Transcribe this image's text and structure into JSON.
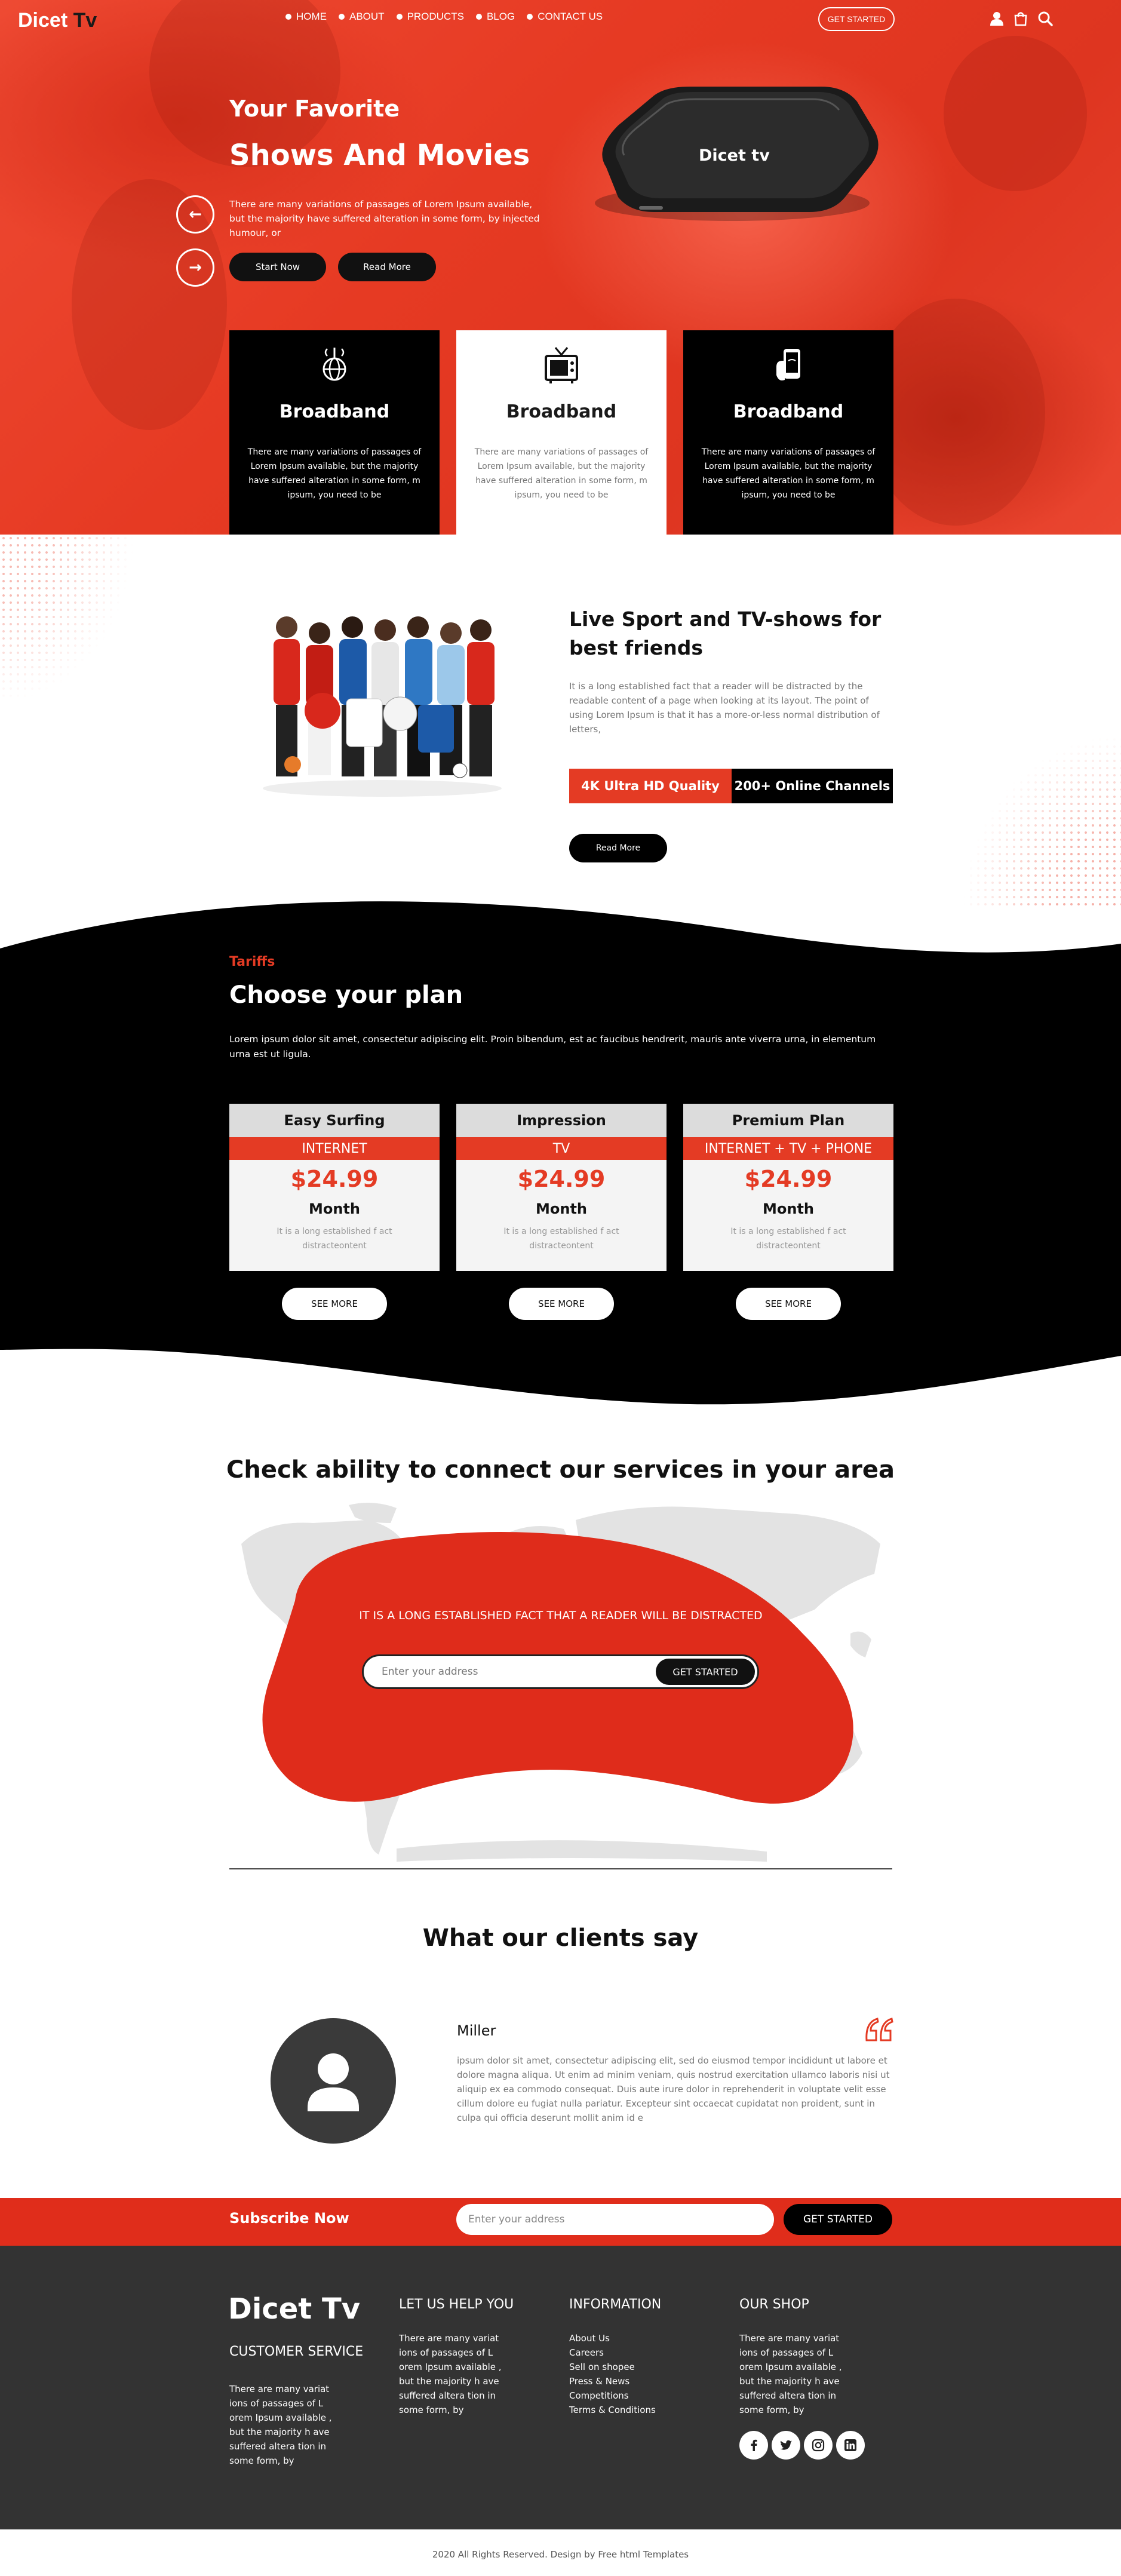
{
  "brand": {
    "name_part1": "Dicet ",
    "name_part2": "Tv",
    "accent_color": "#e43b24"
  },
  "nav": {
    "items": [
      {
        "label": "HOME"
      },
      {
        "label": "ABOUT"
      },
      {
        "label": "PRODUCTS"
      },
      {
        "label": "BLOG"
      },
      {
        "label": "CONTACT US"
      }
    ],
    "cta_label": "GET STARTED",
    "icons": [
      "user-icon",
      "shopping-bag-icon",
      "search-icon"
    ]
  },
  "hero": {
    "title_line1": "Your Favorite",
    "title_line2": "Shows And Movies",
    "paragraph": "There are many variations of passages of Lorem Ipsum available, but the majority have suffered alteration in some form, by injected humour, or",
    "start_button": "Start Now",
    "read_button": "Read More",
    "device_label": "Dicet tv",
    "prev_icon": "arrow-left-icon",
    "next_icon": "arrow-right-icon"
  },
  "features": [
    {
      "icon": "globe-signal-icon",
      "title": "Broadband",
      "text": "There are many variations of passages of Lorem Ipsum available, but the majority have suffered alteration in some form, m ipsum, you need to be"
    },
    {
      "icon": "tv-icon",
      "title": "Broadband",
      "text": "There are many variations of passages of Lorem Ipsum available, but the majority have suffered alteration in some form, m ipsum, you need to be"
    },
    {
      "icon": "phone-hand-icon",
      "title": "Broadband",
      "text": "There are many variations of passages of Lorem Ipsum available, but the majority have suffered alteration in some form, m ipsum, you need to be"
    }
  ],
  "about": {
    "title": "Live Sport and TV-shows for best friends",
    "paragraph": "It is a long established fact that a reader will be distracted by the readable content of a page when looking at its layout. The point of using Lorem Ipsum is that it has a more-or-less normal distribution of letters,",
    "quality_label": "4K Ultra HD Quality",
    "channels_label": "200+ Online Channels",
    "button": "Read More"
  },
  "tariffs": {
    "label": "Tariffs",
    "title": "Choose your plan",
    "paragraph": "Lorem ipsum dolor sit amet, consectetur adipiscing elit. Proin bibendum, est ac faucibus hendrerit, mauris ante viverra urna, in elementum urna est ut ligula.",
    "plans": [
      {
        "name": "Easy Surfing",
        "type": "INTERNET",
        "price": "$24.99",
        "period": "Month",
        "desc": "It is a long established f act distracteontent",
        "button": "SEE MORE"
      },
      {
        "name": "Impression",
        "type": "TV",
        "price": "$24.99",
        "period": "Month",
        "desc": "It is a long established f act distracteontent",
        "button": "SEE MORE"
      },
      {
        "name": "Premium Plan",
        "type": "INTERNET + TV + PHONE",
        "price": "$24.99",
        "period": "Month",
        "desc": "It is a long established f act distracteontent",
        "button": "SEE MORE"
      }
    ]
  },
  "coverage": {
    "title": "Check ability to connect our services in your area",
    "text": "IT IS A LONG ESTABLISHED FACT THAT A READER WILL BE DISTRACTED",
    "input_placeholder": "Enter your address",
    "button": "GET STARTED"
  },
  "testimonials": {
    "title": "What our clients say",
    "name": "Miller",
    "text": "ipsum dolor sit amet, consectetur adipiscing elit, sed do eiusmod tempor incididunt ut labore et dolore magna aliqua. Ut enim ad minim veniam, quis nostrud exercitation ullamco laboris nisi ut aliquip ex ea commodo consequat. Duis aute irure dolor in reprehenderit in voluptate velit esse cillum dolore eu fugiat nulla pariatur. Excepteur sint occaecat cupidatat non proident, sunt in culpa qui officia deserunt mollit anim id e"
  },
  "subscribe": {
    "label": "Subscribe Now",
    "input_placeholder": "Enter your address",
    "button": "GET STARTED"
  },
  "footer": {
    "logo": "Dicet Tv",
    "customer_service_heading": "CUSTOMER SERVICE",
    "customer_service_text": "There are many variat ions of passages of L orem Ipsum available , but the majority h ave suffered altera tion in some form, by",
    "help_heading": "LET US HELP YOU",
    "help_text": "There are many variat ions of passages of L orem Ipsum available , but the majority h ave suffered altera tion in some form, by",
    "info_heading": "INFORMATION",
    "info_links": [
      "About Us",
      "Careers",
      "Sell on shopee",
      "Press & News",
      "Competitions",
      "Terms & Conditions"
    ],
    "shop_heading": "OUR SHOP",
    "shop_text": "There are many variat ions of passages of L orem Ipsum available , but the majority h ave suffered altera tion in some form, by",
    "social_icons": [
      "facebook-icon",
      "twitter-icon",
      "instagram-icon",
      "linkedin-icon"
    ],
    "copyright": "2020 All Rights Reserved. Design by Free html Templates"
  }
}
